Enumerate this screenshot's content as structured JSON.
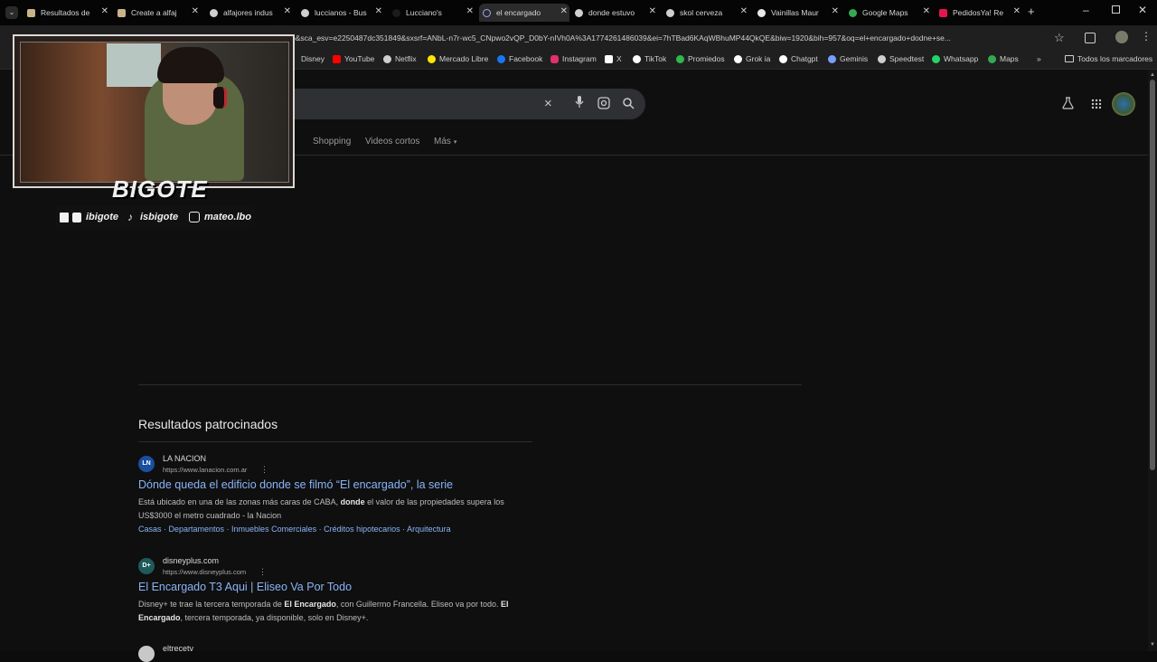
{
  "tabs": [
    {
      "title": "Resultados de",
      "color": "#c9b38a"
    },
    {
      "title": "Create a alfaj",
      "color": "#c9b38a"
    },
    {
      "title": "alfajores indus",
      "color": "#cfcfcf"
    },
    {
      "title": "luccianos - Bus",
      "color": "#cfcfcf"
    },
    {
      "title": "Lucciano's",
      "color": "#1c1c1c"
    },
    {
      "title": "el encargado",
      "color": "#9aa5ff"
    },
    {
      "title": "donde estuvo",
      "color": "#cfcfcf"
    },
    {
      "title": "skol cerveza",
      "color": "#cfcfcf"
    },
    {
      "title": "Vainillas Maur",
      "color": "#e8e8e8"
    },
    {
      "title": "Google Maps",
      "color": "#34a853"
    },
    {
      "title": "PedidosYa! Re",
      "color": "#e4164f"
    }
  ],
  "new_tab_label": "+",
  "omnibox_text": "+grabo&sca_esv=e2250487dc351849&sxsrf=ANbL-n7r-wc5_CNpwo2vQP_D0bY-nIVh0A%3A1774261486039&ei=7hTBad6KAqWBhuMP44QkQE&biw=1920&bih=957&oq=el+encargado+dodne+se...",
  "bookmarks": [
    {
      "label": "Disney",
      "color": "#1f1f1f"
    },
    {
      "label": "YouTube",
      "color": "#ff0000"
    },
    {
      "label": "Netflix",
      "color": "#cfcfcf"
    },
    {
      "label": "Mercado Libre",
      "color": "#ffe600"
    },
    {
      "label": "Facebook",
      "color": "#1877f2"
    },
    {
      "label": "Instagram",
      "color": "#e1306c"
    },
    {
      "label": "X",
      "color": "#ffffff"
    },
    {
      "label": "TikTok",
      "color": "#ffffff"
    },
    {
      "label": "Promiedos",
      "color": "#2fb84b"
    },
    {
      "label": "Grok ia",
      "color": "#ffffff"
    },
    {
      "label": "Chatgpt",
      "color": "#ffffff"
    },
    {
      "label": "Geminis",
      "color": "#7a9cff"
    },
    {
      "label": "Speedtest",
      "color": "#cfcfcf"
    },
    {
      "label": "Whatsapp",
      "color": "#25d366"
    },
    {
      "label": "Maps",
      "color": "#34a853"
    }
  ],
  "bookmarks_more": "»",
  "all_bookmarks": "Todos los marcadores",
  "search": {
    "clear_icon": "×",
    "nav": [
      "Shopping",
      "Videos cortos",
      "Más"
    ]
  },
  "sponsored_heading": "Resultados patrocinados",
  "results": [
    {
      "icon_text": "LN",
      "site": "LA NACION",
      "url": "https://www.lanacion.com.ar",
      "title": "Dónde queda el edificio donde se filmó “El encargado”, la serie",
      "desc_a": "Está ubicado en una de las zonas más caras de CABA,",
      "desc_b": "donde",
      "desc_c": "el valor de las propiedades supera los US$3000 el metro cuadrado - la Nacion",
      "sitelinks": "Casas · Departamentos · Inmuebles Comerciales · Créditos hipotecarios · Arquitectura"
    },
    {
      "icon_text": "D+",
      "site": "disneyplus.com",
      "url": "https://www.disneyplus.com",
      "title": "El Encargado T3 Aqui | Eliseo Va Por Todo",
      "desc_a": "Disney+ te trae la tercera temporada de",
      "desc_b": "El Encargado",
      "desc_c": ", con Guillermo Francella. Eliseo va por todo.",
      "desc_d": "El Encargado",
      "desc_e": ", tercera temporada, ya disponible, solo en Disney+."
    },
    {
      "site": "eltrecetv"
    }
  ],
  "overlay": {
    "brand": "BIGOTE",
    "twitch_kick": "ibigote",
    "tiktok": "isbigote",
    "instagram": "mateo.lbo"
  }
}
